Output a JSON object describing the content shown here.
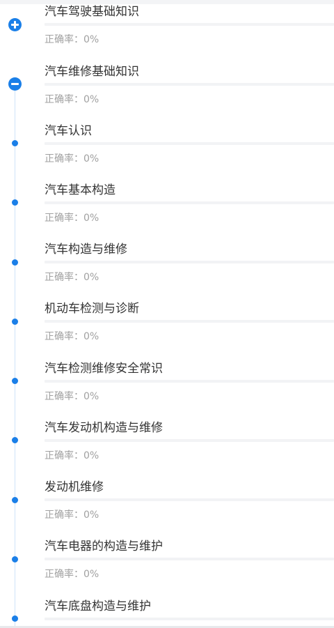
{
  "colors": {
    "accent": "#1a7fe8",
    "title": "#333333",
    "muted": "#a0a0a0",
    "separator": "#f2f3f5"
  },
  "sections": [
    {
      "title": "汽车驾驶基础知识",
      "accuracy": "正确率：0%",
      "marker_icon": "plus-circle-icon"
    },
    {
      "title": "汽车维修基础知识",
      "accuracy": "正确率：0%",
      "marker_icon": "minus-circle-icon"
    },
    {
      "title": "汽车认识",
      "accuracy": "正确率：0%",
      "marker_icon": "dot-icon"
    },
    {
      "title": "汽车基本构造",
      "accuracy": "正确率：0%",
      "marker_icon": "dot-icon"
    },
    {
      "title": "汽车构造与维修",
      "accuracy": "正确率：0%",
      "marker_icon": "dot-icon"
    },
    {
      "title": "机动车检测与诊断",
      "accuracy": "正确率：0%",
      "marker_icon": "dot-icon"
    },
    {
      "title": "汽车检测维修安全常识",
      "accuracy": "正确率：0%",
      "marker_icon": "dot-icon"
    },
    {
      "title": "汽车发动机构造与维修",
      "accuracy": "正确率：0%",
      "marker_icon": "dot-icon"
    },
    {
      "title": "发动机维修",
      "accuracy": "正确率：0%",
      "marker_icon": "dot-icon"
    },
    {
      "title": "汽车电器的构造与维护",
      "accuracy": "正确率：0%",
      "marker_icon": "dot-icon"
    },
    {
      "title": "汽车底盘构造与维护",
      "accuracy": "",
      "marker_icon": "dot-icon"
    }
  ]
}
